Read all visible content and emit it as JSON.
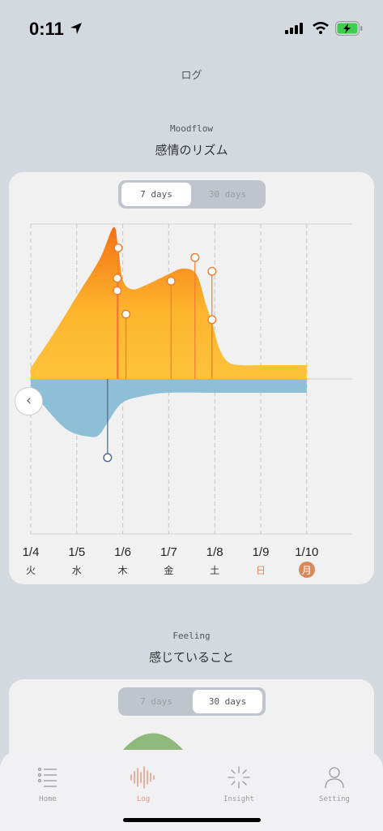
{
  "status": {
    "time": "0:11"
  },
  "page_title": "ログ",
  "moodflow": {
    "subtitle": "Moodflow",
    "title": "感情のリズム",
    "seg_7": "7 days",
    "seg_30": "30 days",
    "back_glyph": "‹"
  },
  "feeling": {
    "subtitle": "Feeling",
    "title": "感じていること",
    "seg_7": "7 days",
    "seg_30": "30 days"
  },
  "chart_data": {
    "type": "area",
    "categories": [
      "1/4",
      "1/5",
      "1/6",
      "1/7",
      "1/8",
      "1/9",
      "1/10"
    ],
    "weekdays": [
      "火",
      "水",
      "木",
      "金",
      "土",
      "日",
      "月"
    ],
    "positive": {
      "x": [
        0,
        0.5,
        1.0,
        1.5,
        1.8,
        1.9,
        2.0,
        2.2,
        2.5,
        3.0,
        3.3,
        3.6,
        3.8,
        3.95,
        4.1,
        4.3,
        4.6,
        5.0,
        5.5,
        6.0
      ],
      "y": [
        0.08,
        0.33,
        0.6,
        0.87,
        1.1,
        0.95,
        0.72,
        0.65,
        0.68,
        0.76,
        0.8,
        0.76,
        0.55,
        0.4,
        0.22,
        0.12,
        0.1,
        0.1,
        0.1,
        0.1
      ]
    },
    "negative": {
      "x": [
        0,
        0.3,
        0.8,
        1.3,
        1.5,
        1.7,
        2.0,
        2.5,
        3.0,
        4.0,
        5.0,
        6.0
      ],
      "y": [
        -0.05,
        -0.2,
        -0.37,
        -0.42,
        -0.4,
        -0.3,
        -0.17,
        -0.12,
        -0.1,
        -0.1,
        -0.1,
        -0.1
      ]
    },
    "pos_markers": [
      {
        "x": 1.9,
        "y": 0.95
      },
      {
        "x": 1.88,
        "y": 0.73
      },
      {
        "x": 1.88,
        "y": 0.64
      },
      {
        "x": 2.07,
        "y": 0.47
      },
      {
        "x": 3.05,
        "y": 0.71
      },
      {
        "x": 3.57,
        "y": 0.88
      },
      {
        "x": 3.94,
        "y": 0.78
      },
      {
        "x": 3.94,
        "y": 0.43
      }
    ],
    "neg_markers": [
      {
        "x": 1.67,
        "y": -0.57
      }
    ],
    "colors": {
      "pos_top": "#f47214",
      "pos_bottom": "#fdc23b",
      "neg": "#8fbfd6",
      "marker": "#f07c30",
      "neg_marker": "#4d6586"
    }
  },
  "tabs": [
    {
      "label": "Home",
      "icon": "list-icon"
    },
    {
      "label": "Log",
      "icon": "waveform-icon"
    },
    {
      "label": "Insight",
      "icon": "sparkle-icon"
    },
    {
      "label": "Setting",
      "icon": "person-icon"
    }
  ]
}
